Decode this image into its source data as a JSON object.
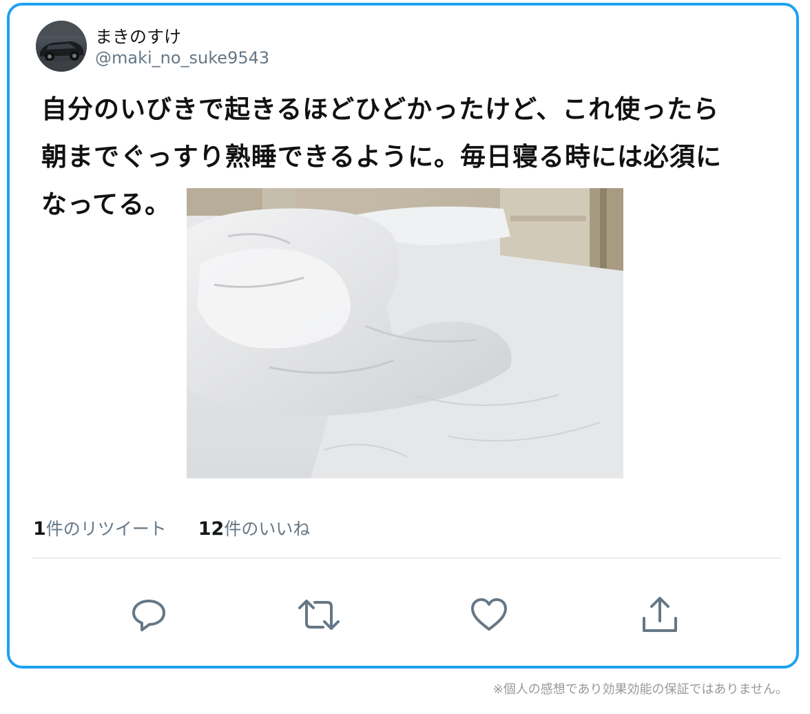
{
  "user": {
    "display_name": "まきのすけ",
    "handle": "@maki_no_suke9543"
  },
  "tweet": {
    "text_line1": "自分のいびきで起きるほどひどかったけど、これ使ったら",
    "text_line2": "朝までぐっすり熟睡できるように。毎日寝る時には必須に",
    "text_line3": "なってる。"
  },
  "stats": {
    "retweets_count": "1",
    "retweets_label": "件のリツイート",
    "likes_count": "12",
    "likes_label": "件のいいね"
  },
  "actions": [
    "reply-icon",
    "retweet-icon",
    "like-icon",
    "share-icon"
  ],
  "colors": {
    "accent": "#1da1f2",
    "icon": "#657786"
  },
  "disclaimer": "※個人の感想であり効果効能の保証ではありません。"
}
